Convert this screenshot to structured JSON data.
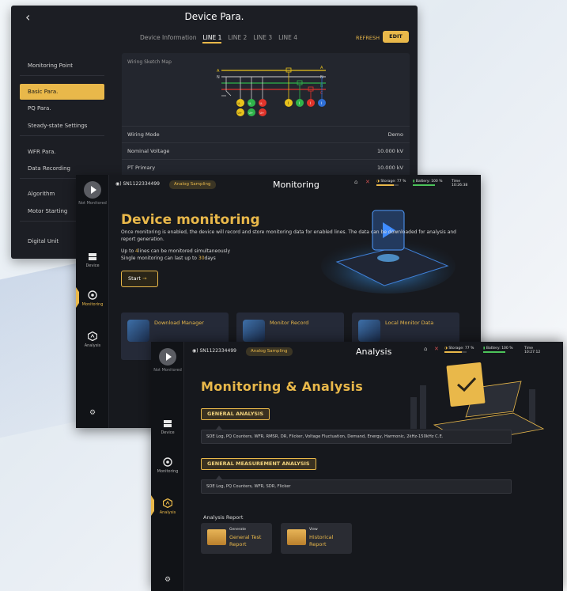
{
  "device_para": {
    "title": "Device Para.",
    "back_icon": "chevron-left-icon",
    "tabs": [
      "Device Information",
      "LINE 1",
      "LINE 2",
      "LINE 3",
      "LINE 4"
    ],
    "active_tab": "LINE 1",
    "refresh_label": "REFRESH",
    "edit_label": "EDIT",
    "menu": [
      "Monitoring Point",
      "Basic Para.",
      "PQ Para.",
      "Steady-state Settings",
      "WFR Para.",
      "Data Recording",
      "Algorithm",
      "Motor Starting",
      "Digital Unit"
    ],
    "active_menu": "Basic Para.",
    "wiring_map_title": "Wiring Sketch Map",
    "diagram": {
      "phase_labels": [
        "A",
        "N",
        "B",
        "C"
      ],
      "meter_labels": [
        "U-",
        "U-",
        "U-",
        "U+",
        "U+",
        "U+"
      ],
      "current_labels": [
        "I",
        "I",
        "I",
        "I"
      ],
      "colors": {
        "yellow": "#e9c21c",
        "green": "#2fb34a",
        "red": "#e0342b",
        "blue": "#2f6fd6"
      }
    },
    "rows": [
      {
        "key": "Wiring Mode",
        "value": "Demo"
      },
      {
        "key": "Nominal Voltage",
        "value": "10.000 kV"
      },
      {
        "key": "PT Primary",
        "value": "10.000 kV"
      }
    ]
  },
  "monitoring": {
    "not_monitored": "Not Monitored",
    "nav": [
      "Device",
      "Monitoring",
      "Analysis"
    ],
    "active_nav": "Monitoring",
    "serial": "SN1122334499",
    "sampling": "Analog Sampling",
    "title": "Monitoring",
    "storage": "Storage: 77 %",
    "battery": "Battery: 100 %",
    "time_label": "Time",
    "time": "10:26:38",
    "heading": "Device monitoring",
    "description": "Once monitoring is enabled, the device will record and store monitoring data for enabled lines. The data can be downloaded for analysis and report generation.",
    "limit_1_prefix": "Up to ",
    "limit_1_value": "4",
    "limit_1_suffix": "lines can be monitored simultaneously",
    "limit_2_prefix": "Single monitoring can last up to ",
    "limit_2_value": "30",
    "limit_2_suffix": "days",
    "start_label": "Start",
    "cards": [
      "Download Manager",
      "Monitor Record",
      "Local Monitor Data"
    ]
  },
  "analysis": {
    "not_monitored": "Not Monitored",
    "nav": [
      "Device",
      "Monitoring",
      "Analysis"
    ],
    "active_nav": "Analysis",
    "serial": "SN1122334499",
    "sampling": "Analog Sampling",
    "title": "Analysis",
    "storage": "Storage: 77 %",
    "battery": "Battery: 100 %",
    "time_label": "Time",
    "time": "10:27:12",
    "heading": "Monitoring & Analysis",
    "general_analysis_label": "GENERAL ANALYSIS",
    "general_analysis_items": "SOE Log, PQ Counters, WFR, RMSR, DR, Flicker, Voltage Fluctuation, Demand, Energy, Harmonic, 2kHz-150kHz C.E.",
    "measurement_label": "GENERAL MEASUREMENT ANALYSIS",
    "measurement_items": "SOE Log, PQ Counters, WFR, SDR, Flicker",
    "report_title": "Analysis Report",
    "report_cards": [
      {
        "small": "Generate",
        "label": "General Test Report"
      },
      {
        "small": "View",
        "label": "Historical Report"
      }
    ]
  },
  "status_levels": {
    "storage_fraction": 0.77,
    "battery_fraction": 1.0
  },
  "accent": "#e9b84a"
}
